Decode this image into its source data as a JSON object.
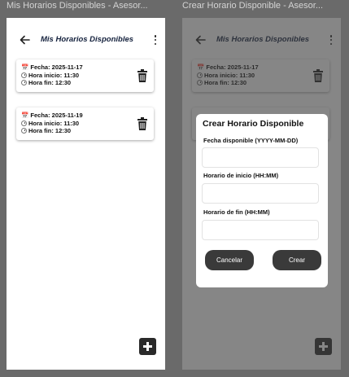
{
  "windows": {
    "left_title": "Mis Horarios Disponibles - Asesor...",
    "right_title": "Crear Horario Disponible - Asesor..."
  },
  "app": {
    "title": "Mis Horarios Disponibles"
  },
  "schedules": [
    {
      "fecha": "📅 Fecha: 2025-11-17",
      "inicio": "Hora inicio: 11:30",
      "fin": "Hora fin: 12:30"
    },
    {
      "fecha": "📅 Fecha: 2025-11-19",
      "inicio": "Hora inicio: 11:30",
      "fin": "Hora fin: 12:30"
    }
  ],
  "dialog": {
    "title": "Crear Horario Disponible",
    "date_label": "Fecha disponible (YYYY-MM-DD)",
    "date_value": "",
    "start_label": "Horario de inicio (HH:MM)",
    "start_value": "",
    "end_label": "Horario de fin (HH:MM)",
    "end_value": "",
    "cancel_label": "Cancelar",
    "create_label": "Crear"
  },
  "colors": {
    "title_text": "#14213d",
    "calendar_icon": "#c0392b",
    "fab": "#2a2a2a",
    "dialog_button": "#3a3a3a"
  },
  "icons": [
    "back-arrow-icon",
    "kebab-menu-icon",
    "calendar-icon",
    "clock-icon",
    "trash-icon",
    "add-icon"
  ]
}
